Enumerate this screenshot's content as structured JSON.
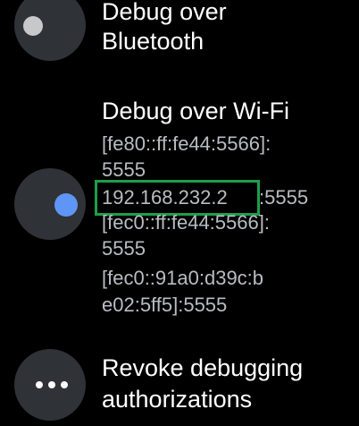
{
  "settings": {
    "bluetooth_debug": {
      "title_line1": "Debug over",
      "title_line2": "Bluetooth",
      "enabled": false
    },
    "wifi_debug": {
      "title": "Debug over Wi-Fi",
      "enabled": true,
      "addresses": [
        "[fe80::ff:fe44:5566]:",
        "5555",
        "192.168.232.2",
        ":5555",
        "[fec0::ff:fe44:5566]:",
        "5555",
        "[fec0::91a0:d39c:b",
        "e02:5ff5]:5555"
      ]
    },
    "revoke": {
      "title_line1": "Revoke debugging",
      "title_line2": "authorizations"
    }
  },
  "colors": {
    "toggle_off": "#c7c8ca",
    "toggle_on": "#5f95f5",
    "icon_bg": "#2f3236",
    "highlight": "#1e9e4a"
  },
  "icons": {
    "toggle_off": "toggle-off-icon",
    "toggle_on": "toggle-on-icon",
    "more": "more-horizontal-icon"
  }
}
